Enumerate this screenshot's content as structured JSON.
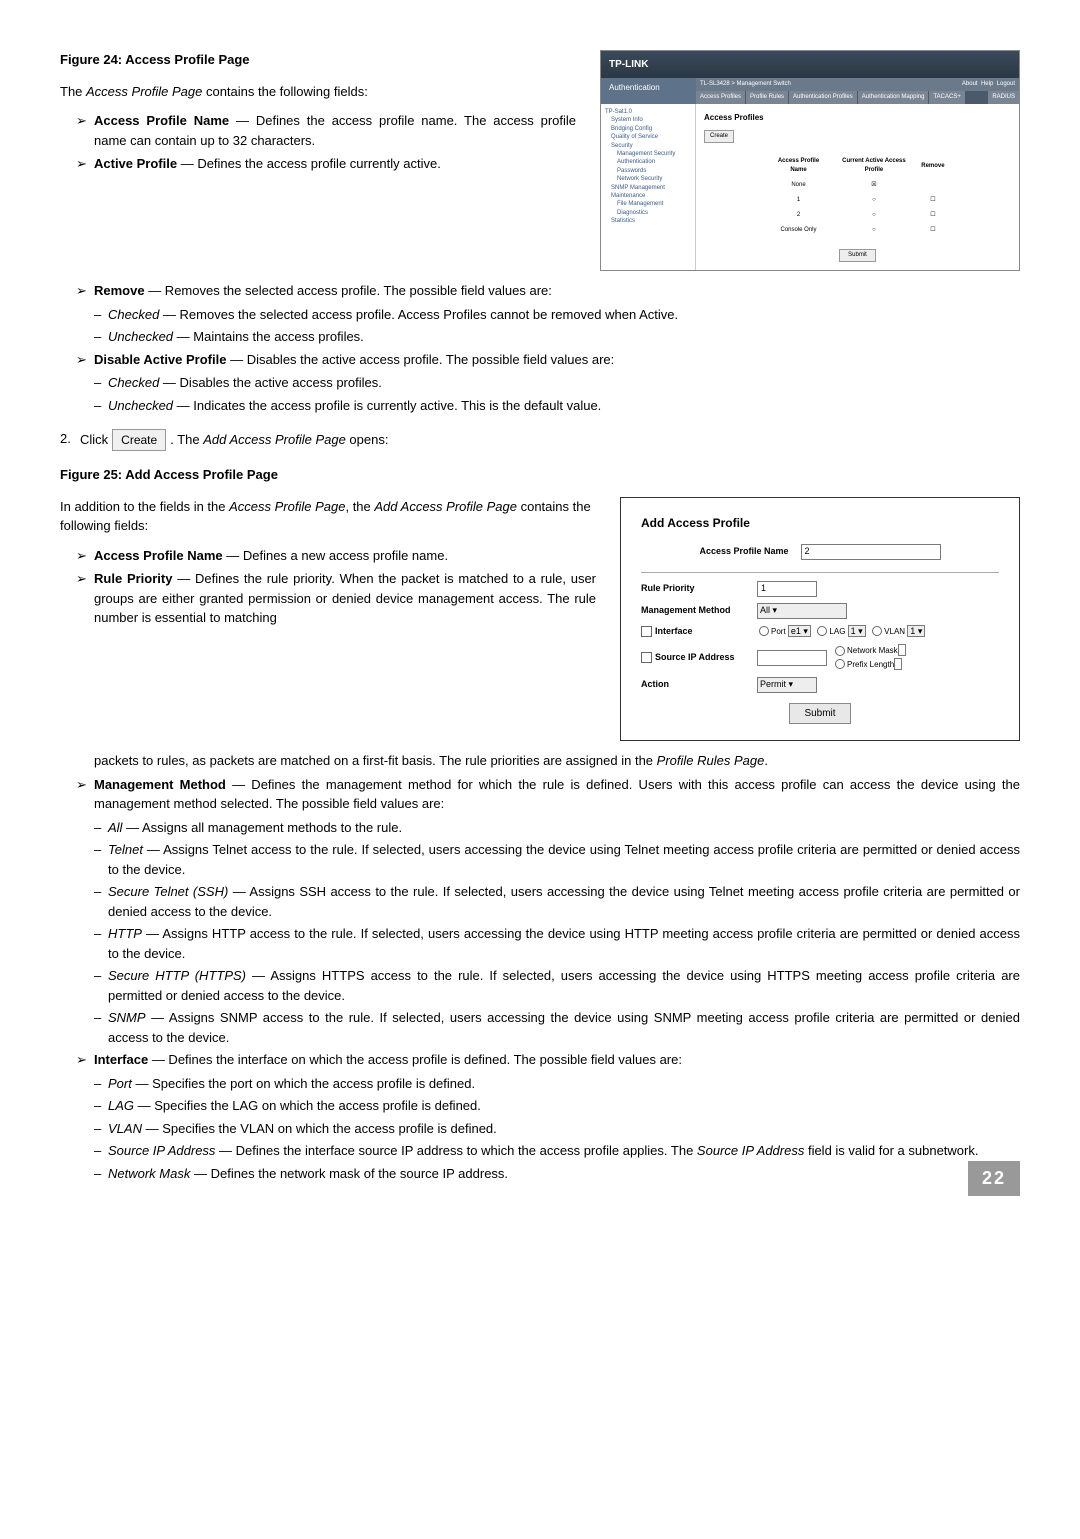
{
  "fig24": {
    "heading": "Figure 24: Access Profile Page",
    "intro": "The Access Profile Page contains the following fields:",
    "screenshot": {
      "brand": "TP-LINK",
      "sidebar_title": "Authentication",
      "breadcrumb": "TL-SL3428 > Management Switch",
      "tabs": [
        "Access Profiles",
        "Profile Rules",
        "Authentication Profiles",
        "Authentication Mapping",
        "TACACS+"
      ],
      "right_links": [
        "About",
        "Help",
        "Logout"
      ],
      "main_title": "Access Profiles",
      "create_btn": "Create",
      "nav_items": [
        "TP-Sat1.0",
        "System Info",
        "Bridging Config",
        "Quality of Service",
        "Security",
        "Management Security",
        "Authentication",
        "Passwords",
        "Network Security",
        "SNMP Management",
        "Maintenance",
        "File Management",
        "Diagnostics",
        "Statistics"
      ],
      "table_headers": [
        "Access Profile Name",
        "Current Active Access Profile",
        "Remove"
      ],
      "table_rows": [
        [
          "None",
          "☒",
          ""
        ],
        [
          "1",
          "○",
          "☐"
        ],
        [
          "2",
          "○",
          "☐"
        ],
        [
          "Console Only",
          "○",
          "☐"
        ]
      ],
      "submit_btn": "Submit",
      "radius": "RADIUS"
    },
    "bullets": [
      {
        "term": "Access Profile Name",
        "desc": " — Defines the access profile name. The access profile name can contain up to 32 characters."
      },
      {
        "term": "Active Profile",
        "desc": " — Defines the access profile currently active."
      },
      {
        "term": "Remove",
        "desc": " — Removes the selected access profile. The possible field values are:",
        "subs": [
          {
            "em": "Checked",
            "text": " — Removes the selected access profile. Access Profiles cannot be removed when Active."
          },
          {
            "em": "Unchecked",
            "text": " — Maintains the access profiles."
          }
        ]
      },
      {
        "term": "Disable Active Profile",
        "desc": " — Disables the active access profile. The possible field values are:",
        "subs": [
          {
            "em": "Checked",
            "text": " — Disables the active access profiles."
          },
          {
            "em": "Unchecked",
            "text": " — Indicates the access profile is currently active. This is the default value."
          }
        ]
      }
    ],
    "step": {
      "num": "2.",
      "pre": "Click",
      "btn": "Create",
      "post": ". The Add Access Profile Page opens:"
    }
  },
  "fig25": {
    "heading": "Figure 25: Add Access Profile Page",
    "intro": "In addition to the fields in the Access Profile Page, the Add Access Profile Page contains the following fields:",
    "screenshot": {
      "title": "Add Access Profile",
      "name_label": "Access Profile Name",
      "name_value": "2",
      "priority_label": "Rule Priority",
      "priority_value": "1",
      "method_label": "Management Method",
      "method_value": "All",
      "iface_label": "Interface",
      "port_label": "Port",
      "port_value": "e1",
      "lag_label": "LAG",
      "lag_value": "1",
      "vlan_label": "VLAN",
      "vlan_value": "1",
      "srcip_label": "Source IP Address",
      "nmask_label": "Network Mask",
      "plen_label": "Prefix Length",
      "action_label": "Action",
      "action_value": "Permit",
      "submit_btn": "Submit"
    },
    "bullets_left": [
      {
        "term": "Access Profile Name",
        "desc": " — Defines a new access profile name."
      },
      {
        "term": "Rule Priority",
        "desc": " — Defines the rule priority. When the packet is matched to a rule, user groups are either granted permission or denied device management access. The rule number is essential to matching"
      }
    ],
    "continuation": "packets to rules, as packets are matched on a first-fit basis. The rule priorities are assigned in the Profile Rules Page.",
    "bullets_full": [
      {
        "term": "Management Method",
        "desc": " — Defines the management method for which the rule is defined. Users with this access profile can access the device using the management method selected. The possible field values are:",
        "subs": [
          {
            "em": "All",
            "text": " — Assigns all management methods to the rule."
          },
          {
            "em": "Telnet",
            "text": " — Assigns Telnet access to the rule. If selected, users accessing the device using Telnet meeting access profile criteria are permitted or denied access to the device."
          },
          {
            "em": "Secure Telnet (SSH)",
            "text": " — Assigns SSH access to the rule. If selected, users accessing the device using Telnet meeting access profile criteria are permitted or denied access to the device."
          },
          {
            "em": "HTTP",
            "text": " — Assigns HTTP access to the rule. If selected, users accessing the device using HTTP meeting access profile criteria are permitted or denied access to the device."
          },
          {
            "em": "Secure HTTP (HTTPS)",
            "text": " — Assigns HTTPS access to the rule. If selected, users accessing the device using HTTPS meeting access profile criteria are permitted or denied access to the device."
          },
          {
            "em": "SNMP",
            "text": " — Assigns SNMP access to the rule. If selected, users accessing the device using SNMP meeting access profile criteria are permitted or denied access to the device."
          }
        ]
      },
      {
        "term": "Interface",
        "desc": " — Defines the interface on which the access profile is defined. The possible field values are:",
        "subs": [
          {
            "em": "Port",
            "text": " — Specifies the port on which the access profile is defined."
          },
          {
            "em": "LAG",
            "text": " — Specifies the LAG on which the access profile is defined."
          },
          {
            "em": "VLAN",
            "text": " — Specifies the VLAN on which the access profile is defined."
          },
          {
            "em": "Source IP Address",
            "text": " — Defines the interface source IP address to which the access profile applies. The Source IP Address field is valid for a subnetwork."
          },
          {
            "em": "Network Mask",
            "text": " — Defines the network mask of the source IP address."
          }
        ]
      }
    ]
  },
  "page_number": "22"
}
